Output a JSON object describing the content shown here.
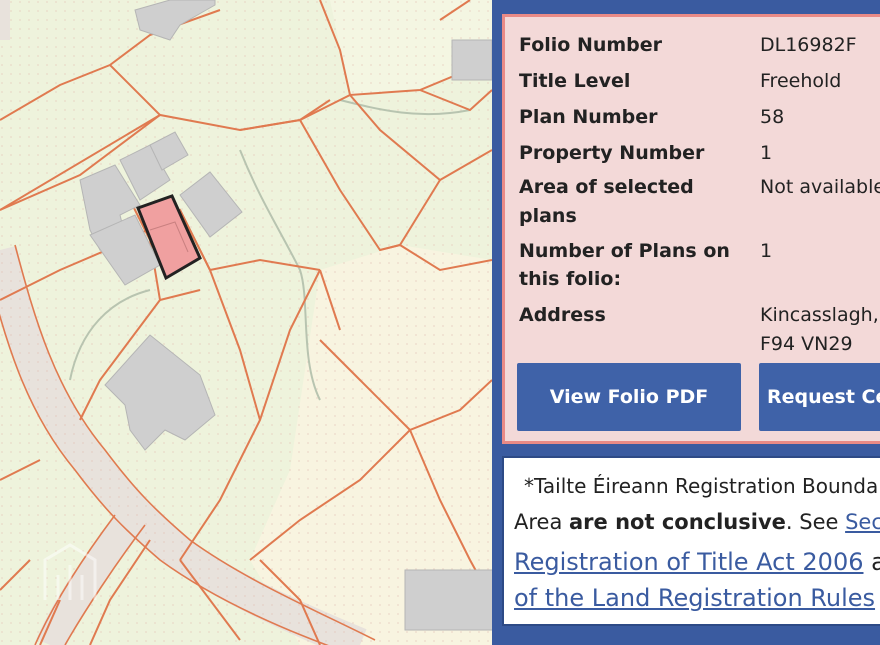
{
  "folio": {
    "rows": [
      {
        "key": "Folio Number",
        "value": "DL16982F"
      },
      {
        "key": "Title Level",
        "value": "Freehold"
      },
      {
        "key": "Plan Number",
        "value": "58"
      },
      {
        "key": "Property Number",
        "value": "1"
      },
      {
        "key_line1": "Area of selected",
        "key_line2": "plans",
        "value": "Not available"
      },
      {
        "key_line1": "Number of Plans on",
        "key_line2": "this folio:",
        "value": "1"
      },
      {
        "key": "Address",
        "value_line1": "Kincasslagh,",
        "value_line2": "F94 VN29"
      }
    ],
    "buttons": {
      "view_pdf": "View Folio PDF",
      "request_cert": "Request Ce"
    }
  },
  "note": {
    "line1": "*Tailte Éireann Registration Bounda",
    "line2_pre": "Area ",
    "line2_bold": "are not conclusive",
    "line2_mid": ". See ",
    "line2_link": "Sect",
    "line3_link": "Registration of Title Act 2006",
    "line3_post": " a",
    "line4_link": "of the Land Registration Rules"
  },
  "colors": {
    "panel_bg": "#3a5ba0",
    "info_bg": "#f3d9d8",
    "info_border": "#e98a86",
    "button_bg": "#3f62a8",
    "map_bg": "#eef3dc",
    "boundary": "#e07a50",
    "building": "#cfcfcf",
    "selected_plot": "#f0a0a0"
  }
}
